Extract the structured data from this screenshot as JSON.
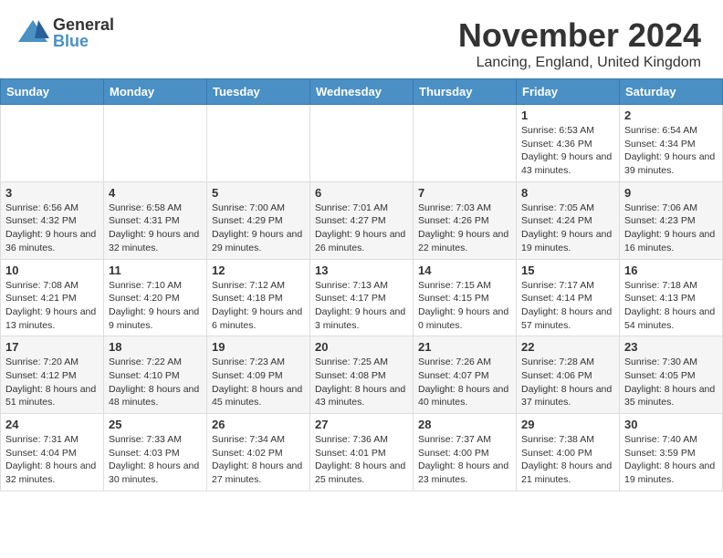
{
  "header": {
    "logo_general": "General",
    "logo_blue": "Blue",
    "title": "November 2024",
    "location": "Lancing, England, United Kingdom"
  },
  "weekdays": [
    "Sunday",
    "Monday",
    "Tuesday",
    "Wednesday",
    "Thursday",
    "Friday",
    "Saturday"
  ],
  "weeks": [
    [
      {
        "day": "",
        "info": ""
      },
      {
        "day": "",
        "info": ""
      },
      {
        "day": "",
        "info": ""
      },
      {
        "day": "",
        "info": ""
      },
      {
        "day": "",
        "info": ""
      },
      {
        "day": "1",
        "info": "Sunrise: 6:53 AM\nSunset: 4:36 PM\nDaylight: 9 hours and 43 minutes."
      },
      {
        "day": "2",
        "info": "Sunrise: 6:54 AM\nSunset: 4:34 PM\nDaylight: 9 hours and 39 minutes."
      }
    ],
    [
      {
        "day": "3",
        "info": "Sunrise: 6:56 AM\nSunset: 4:32 PM\nDaylight: 9 hours and 36 minutes."
      },
      {
        "day": "4",
        "info": "Sunrise: 6:58 AM\nSunset: 4:31 PM\nDaylight: 9 hours and 32 minutes."
      },
      {
        "day": "5",
        "info": "Sunrise: 7:00 AM\nSunset: 4:29 PM\nDaylight: 9 hours and 29 minutes."
      },
      {
        "day": "6",
        "info": "Sunrise: 7:01 AM\nSunset: 4:27 PM\nDaylight: 9 hours and 26 minutes."
      },
      {
        "day": "7",
        "info": "Sunrise: 7:03 AM\nSunset: 4:26 PM\nDaylight: 9 hours and 22 minutes."
      },
      {
        "day": "8",
        "info": "Sunrise: 7:05 AM\nSunset: 4:24 PM\nDaylight: 9 hours and 19 minutes."
      },
      {
        "day": "9",
        "info": "Sunrise: 7:06 AM\nSunset: 4:23 PM\nDaylight: 9 hours and 16 minutes."
      }
    ],
    [
      {
        "day": "10",
        "info": "Sunrise: 7:08 AM\nSunset: 4:21 PM\nDaylight: 9 hours and 13 minutes."
      },
      {
        "day": "11",
        "info": "Sunrise: 7:10 AM\nSunset: 4:20 PM\nDaylight: 9 hours and 9 minutes."
      },
      {
        "day": "12",
        "info": "Sunrise: 7:12 AM\nSunset: 4:18 PM\nDaylight: 9 hours and 6 minutes."
      },
      {
        "day": "13",
        "info": "Sunrise: 7:13 AM\nSunset: 4:17 PM\nDaylight: 9 hours and 3 minutes."
      },
      {
        "day": "14",
        "info": "Sunrise: 7:15 AM\nSunset: 4:15 PM\nDaylight: 9 hours and 0 minutes."
      },
      {
        "day": "15",
        "info": "Sunrise: 7:17 AM\nSunset: 4:14 PM\nDaylight: 8 hours and 57 minutes."
      },
      {
        "day": "16",
        "info": "Sunrise: 7:18 AM\nSunset: 4:13 PM\nDaylight: 8 hours and 54 minutes."
      }
    ],
    [
      {
        "day": "17",
        "info": "Sunrise: 7:20 AM\nSunset: 4:12 PM\nDaylight: 8 hours and 51 minutes."
      },
      {
        "day": "18",
        "info": "Sunrise: 7:22 AM\nSunset: 4:10 PM\nDaylight: 8 hours and 48 minutes."
      },
      {
        "day": "19",
        "info": "Sunrise: 7:23 AM\nSunset: 4:09 PM\nDaylight: 8 hours and 45 minutes."
      },
      {
        "day": "20",
        "info": "Sunrise: 7:25 AM\nSunset: 4:08 PM\nDaylight: 8 hours and 43 minutes."
      },
      {
        "day": "21",
        "info": "Sunrise: 7:26 AM\nSunset: 4:07 PM\nDaylight: 8 hours and 40 minutes."
      },
      {
        "day": "22",
        "info": "Sunrise: 7:28 AM\nSunset: 4:06 PM\nDaylight: 8 hours and 37 minutes."
      },
      {
        "day": "23",
        "info": "Sunrise: 7:30 AM\nSunset: 4:05 PM\nDaylight: 8 hours and 35 minutes."
      }
    ],
    [
      {
        "day": "24",
        "info": "Sunrise: 7:31 AM\nSunset: 4:04 PM\nDaylight: 8 hours and 32 minutes."
      },
      {
        "day": "25",
        "info": "Sunrise: 7:33 AM\nSunset: 4:03 PM\nDaylight: 8 hours and 30 minutes."
      },
      {
        "day": "26",
        "info": "Sunrise: 7:34 AM\nSunset: 4:02 PM\nDaylight: 8 hours and 27 minutes."
      },
      {
        "day": "27",
        "info": "Sunrise: 7:36 AM\nSunset: 4:01 PM\nDaylight: 8 hours and 25 minutes."
      },
      {
        "day": "28",
        "info": "Sunrise: 7:37 AM\nSunset: 4:00 PM\nDaylight: 8 hours and 23 minutes."
      },
      {
        "day": "29",
        "info": "Sunrise: 7:38 AM\nSunset: 4:00 PM\nDaylight: 8 hours and 21 minutes."
      },
      {
        "day": "30",
        "info": "Sunrise: 7:40 AM\nSunset: 3:59 PM\nDaylight: 8 hours and 19 minutes."
      }
    ]
  ]
}
